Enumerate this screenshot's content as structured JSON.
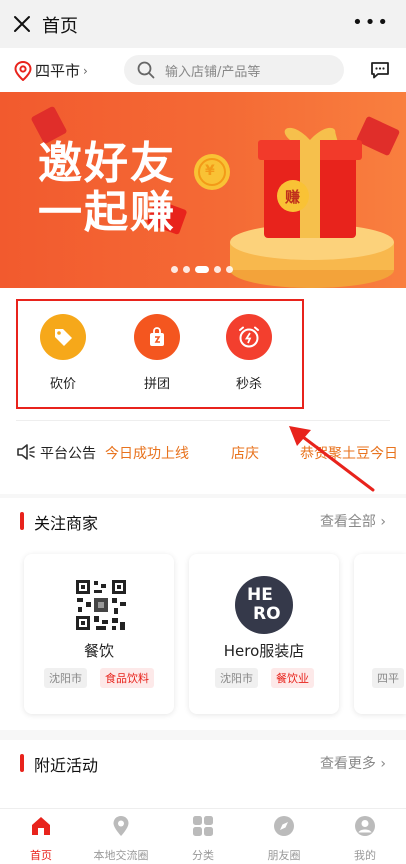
{
  "titlebar": {
    "title": "首页",
    "more": "•••"
  },
  "location": {
    "city": "四平市",
    "chevron": "›"
  },
  "search": {
    "placeholder": "输入店铺/产品等"
  },
  "banner": {
    "line1": "邀好友",
    "line2": "一起赚",
    "gift_label": "赚",
    "coin_symbol": "¥",
    "slide_count": 5,
    "active_slide": 3
  },
  "quick_actions": [
    {
      "label": "砍价",
      "icon": "price-tag-icon",
      "color": "#f6a81a"
    },
    {
      "label": "拼团",
      "icon": "shopping-bag-icon",
      "color": "#f4561f"
    },
    {
      "label": "秒杀",
      "icon": "alarm-clock-icon",
      "color": "#f33f2e"
    }
  ],
  "notice": {
    "label": "平台公告",
    "items": [
      "今日成功上线",
      "店庆",
      "恭贺聚土豆今日"
    ]
  },
  "featured": {
    "title": "关注商家",
    "more": "查看全部 ›",
    "shops": [
      {
        "name": "餐饮",
        "logo": "qr-code-logo",
        "tags": [
          "沈阳市",
          "食品饮料"
        ]
      },
      {
        "name": "Hero服装店",
        "logo": "hero-logo",
        "logo_text_top": "HE",
        "logo_text_bottom": "RO",
        "tags": [
          "沈阳市",
          "餐饮业"
        ]
      },
      {
        "name": "",
        "logo": "",
        "tags": [
          "四平"
        ]
      }
    ]
  },
  "nearby": {
    "title": "附近活动",
    "more": "查看更多 ›"
  },
  "tabbar": [
    {
      "label": "首页",
      "icon": "home-icon",
      "active": true
    },
    {
      "label": "本地交流圈",
      "icon": "location-pin-icon",
      "active": false
    },
    {
      "label": "分类",
      "icon": "grid-icon",
      "active": false
    },
    {
      "label": "朋友圈",
      "icon": "compass-icon",
      "active": false
    },
    {
      "label": "我的",
      "icon": "user-icon",
      "active": false
    }
  ],
  "colors": {
    "accent": "#e8231c",
    "notice_text": "#e8731e",
    "banner": "#f25a2e"
  }
}
